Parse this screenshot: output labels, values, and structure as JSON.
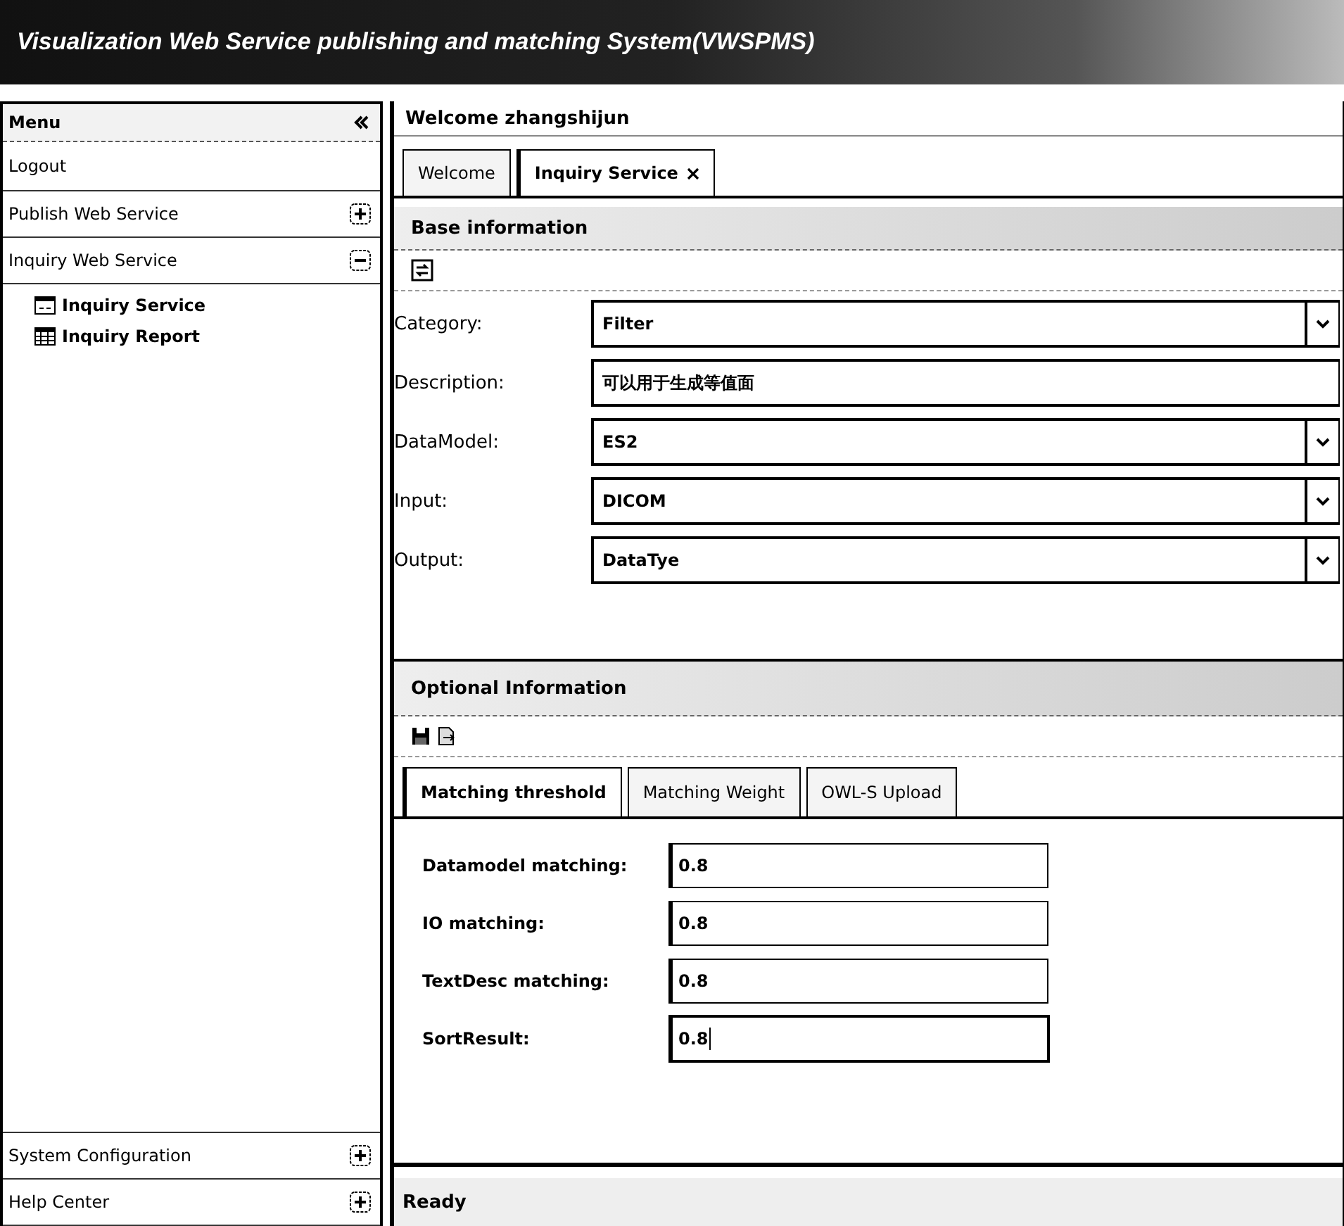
{
  "window": {
    "title": "Visualization Web Service publishing and matching System(VWSPMS)"
  },
  "sidebar": {
    "header": "Menu",
    "items": [
      {
        "kind": "link",
        "label": "Logout"
      },
      {
        "kind": "section",
        "label": "Publish Web Service",
        "expanded": false
      },
      {
        "kind": "section",
        "label": "Inquiry Web Service",
        "expanded": true,
        "children": [
          {
            "kind": "form",
            "label": "Inquiry Service"
          },
          {
            "kind": "grid",
            "label": "Inquiry Report"
          }
        ]
      }
    ],
    "bottom_items": [
      {
        "label": "System Configuration",
        "expanded": false
      },
      {
        "label": "Help Center",
        "expanded": false
      }
    ]
  },
  "main": {
    "welcome": "Welcome zhangshijun",
    "tabs": [
      {
        "label": "Welcome",
        "selected": false,
        "closable": false
      },
      {
        "label": "Inquiry Service",
        "selected": true,
        "closable": true
      }
    ],
    "base_information": {
      "title": "Base information",
      "fields": [
        {
          "kind": "select",
          "label": "Category:",
          "value": "Filter"
        },
        {
          "kind": "text",
          "label": "Description:",
          "value": "可以用于生成等值面"
        },
        {
          "kind": "select",
          "label": "DataModel:",
          "value": "ES2"
        },
        {
          "kind": "select",
          "label": "Input:",
          "value": "DICOM"
        },
        {
          "kind": "select",
          "label": "Output:",
          "value": "DataTye"
        }
      ]
    },
    "optional_information": {
      "title": "Optional Information",
      "tabs": [
        {
          "label": "Matching threshold",
          "selected": true
        },
        {
          "label": "Matching Weight",
          "selected": false
        },
        {
          "label": "OWL-S Upload",
          "selected": false
        }
      ],
      "fields": [
        {
          "label": "Datamodel matching:",
          "value": "0.8",
          "focused": false
        },
        {
          "label": "IO matching:",
          "value": "0.8",
          "focused": false
        },
        {
          "label": "TextDesc matching:",
          "value": "0.8",
          "focused": false
        },
        {
          "label": "SortResult:",
          "value": "0.8",
          "focused": true
        }
      ]
    },
    "status": "Ready"
  }
}
